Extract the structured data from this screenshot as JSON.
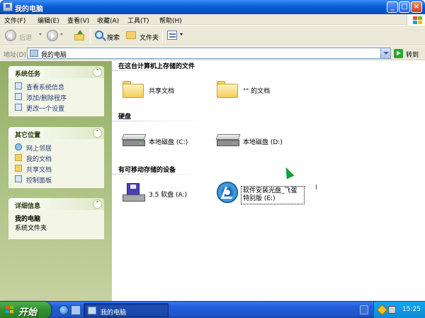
{
  "window": {
    "title": "我的电脑",
    "controls": {
      "minimize": "_",
      "maximize": "□",
      "close": "×"
    }
  },
  "menu": [
    "文件(F)",
    "编辑(E)",
    "查看(V)",
    "收藏(A)",
    "工具(T)",
    "帮助(H)"
  ],
  "toolbar": {
    "back": "后退",
    "search": "搜索",
    "folders": "文件夹"
  },
  "address": {
    "label": "地址(D)",
    "value": "我的电脑",
    "go": "转到"
  },
  "left": {
    "system_tasks": {
      "title": "系统任务",
      "items": [
        "查看系统信息",
        "添加/删除程序",
        "更改一个设置"
      ]
    },
    "other_places": {
      "title": "其它位置",
      "items": [
        "网上邻居",
        "我的文档",
        "共享文档",
        "控制面板"
      ]
    },
    "details": {
      "title": "详细信息",
      "name": "我的电脑",
      "type": "系统文件夹"
    },
    "collapse_glyph": "⌃"
  },
  "main": {
    "files_section": "在这台计算机上存储的文件",
    "files": [
      "共享文档",
      "\"\" 的文档"
    ],
    "drives_section": "硬盘",
    "drives": [
      "本地磁盘 (C:)",
      "本地磁盘 (D:)"
    ],
    "removable_section": "有可移动存储的设备",
    "removable": [
      "3.5 软盘 (A:)",
      "软件安装光盘_飞蛋特别版 (E:)"
    ]
  },
  "taskbar": {
    "start": "开始",
    "task": "我的电脑",
    "clock": "15:25"
  },
  "colors": {
    "title_blue": "#0a5fd8",
    "task_pane_green": "#a2bb78",
    "taskbar_blue": "#245edb",
    "start_green": "#2f8f2f"
  }
}
